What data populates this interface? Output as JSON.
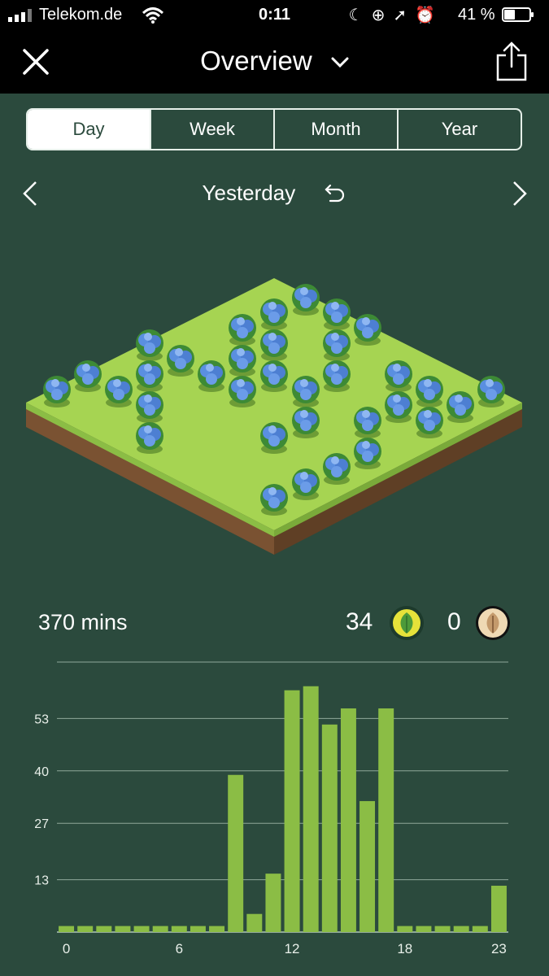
{
  "status_bar": {
    "carrier": "Telekom.de",
    "time": "0:11",
    "battery": "41 %",
    "icons": [
      "moon-icon",
      "orientation-lock-icon",
      "location-arrow-icon",
      "alarm-icon"
    ]
  },
  "nav": {
    "title": "Overview",
    "close_icon": "close-icon",
    "share_icon": "share-icon",
    "dropdown_icon": "chevron-down-icon"
  },
  "tabs": [
    {
      "label": "Day",
      "active": true
    },
    {
      "label": "Week",
      "active": false
    },
    {
      "label": "Month",
      "active": false
    },
    {
      "label": "Year",
      "active": false
    }
  ],
  "date_nav": {
    "label": "Yesterday",
    "undo_icon": "undo-icon"
  },
  "stats": {
    "minutes": "370 mins",
    "trees": "34",
    "dead_trees": "0",
    "tree_icon": "leaf-icon",
    "dead_icon": "withered-leaf-icon"
  },
  "colors": {
    "background": "#2b4a3d",
    "bar": "#8bbd45",
    "accent_badge": "#e6e23a"
  },
  "chart_data": {
    "type": "bar",
    "x": [
      0,
      1,
      2,
      3,
      4,
      5,
      6,
      7,
      8,
      9,
      10,
      11,
      12,
      13,
      14,
      15,
      16,
      17,
      18,
      19,
      20,
      21,
      22,
      23
    ],
    "values": [
      1.5,
      1.5,
      1.5,
      1.5,
      1.5,
      1.5,
      1.5,
      1.5,
      1.5,
      39,
      4.5,
      14.5,
      60,
      61,
      51.5,
      55.5,
      32.5,
      55.5,
      1.5,
      1.5,
      1.5,
      1.5,
      1.5,
      11.5
    ],
    "x_tick_labels": [
      "0",
      "6",
      "12",
      "18",
      "23"
    ],
    "y_tick_labels": [
      "13",
      "27",
      "40",
      "53"
    ],
    "ylim": [
      0,
      67
    ],
    "grid": true
  }
}
